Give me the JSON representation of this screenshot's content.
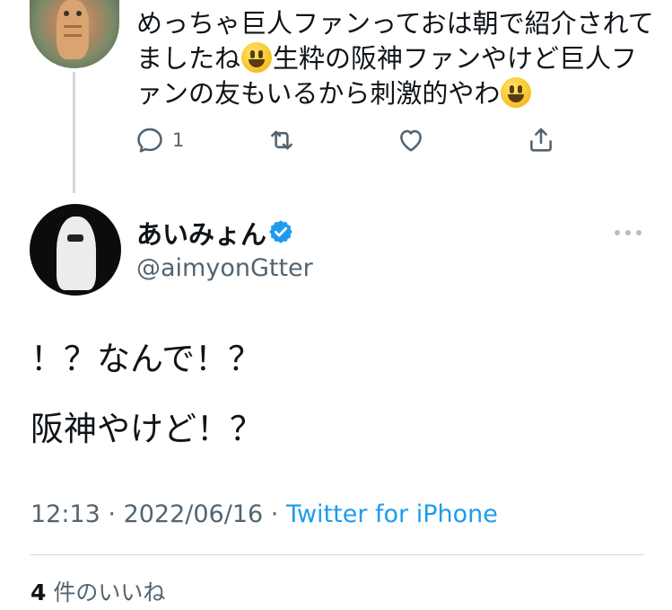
{
  "previous_tweet": {
    "lines": [
      "めっちゃ巨人ファンっておは朝で紹介されて",
      "ましたね",
      "生粋の阪神ファンやけど巨人フ",
      "ァンの友もいるから刺激的やわ"
    ],
    "reply_count": "1"
  },
  "author": {
    "name": "あいみょん",
    "handle": "@aimyonGtter",
    "verified": true
  },
  "tweet": {
    "paragraphs": [
      "！？なんで！？",
      "阪神やけど！？"
    ],
    "time": "12:13",
    "date": "2022/06/16",
    "separator": " · ",
    "source": "Twitter for iPhone"
  },
  "likes": {
    "count": "4",
    "label": "件のいいね"
  },
  "colors": {
    "accent": "#1d9bf0",
    "secondary_text": "#536471",
    "divider": "#cfd9de"
  }
}
